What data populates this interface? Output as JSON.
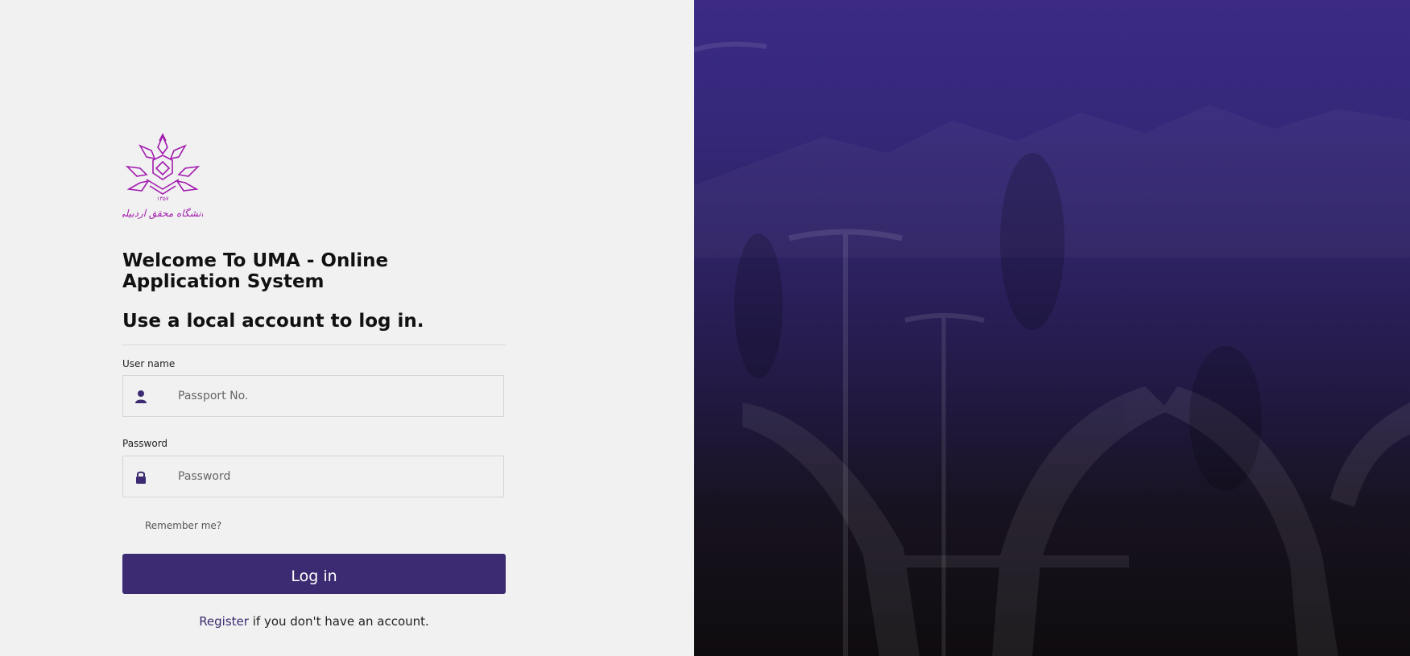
{
  "brand": {
    "logo_icon": "university-mohaghegh-ardabili-logo",
    "logo_year": "۱۳۵۷",
    "logo_name": "دانشگاه محقق اردبیلی",
    "accent_color": "#3c2b72"
  },
  "login": {
    "title": "Welcome To UMA - Online Application System",
    "subtitle": "Use a local account to log in.",
    "username_label": "User name",
    "username_placeholder": "Passport No.",
    "username_icon": "user-icon",
    "password_label": "Password",
    "password_placeholder": "Password",
    "password_icon": "lock-icon",
    "remember_label": "Remember me?",
    "login_button": "Log in",
    "register_link": "Register",
    "register_suffix": " if you don't have an account."
  }
}
